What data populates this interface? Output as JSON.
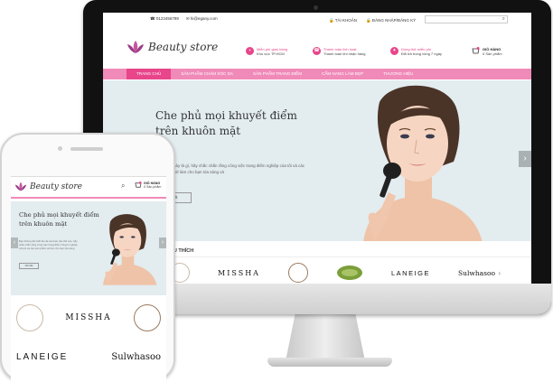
{
  "colors": {
    "accent": "#e8458b",
    "nav": "#f08ab8",
    "hero_bg": "#e3ecef"
  },
  "desktop": {
    "phone": "0123456789",
    "email": "hi@egany.com",
    "account": "TÀI KHOẢN",
    "login": "ĐĂNG NHẬP/ĐĂNG KÝ",
    "logo": "Beauty store",
    "features": [
      {
        "title": "Miễn phí giao hàng",
        "sub": "Khu vực TP.HCM",
        "icon": "truck-icon"
      },
      {
        "title": "Thanh toán linh hoạt",
        "sub": "Thanh toán khi nhận hàng",
        "icon": "phone-icon"
      },
      {
        "title": "Dùng thử miễn phí",
        "sub": "Đổi trả trong vòng 7 ngày",
        "icon": "gift-icon"
      }
    ],
    "cart": {
      "title": "GIỎ HÀNG",
      "count": "0",
      "sub": "Sản phẩm"
    },
    "nav": [
      "TRANG CHỦ",
      "SẢN PHẨM CHĂM SÓC DA",
      "SẢN PHẨM TRANG ĐIỂM",
      "CẨM NANG LÀM ĐẸP",
      "THƯƠNG HIỆU"
    ],
    "hero": {
      "title_line1": "Che phủ mọi khuyết điểm",
      "title_line2": "trên khuôn mặt",
      "text": "nhân đẹp này là gì, hãy chắc chắn rằng công việc trang điểm nghiệp của tôi và các sản phẩm sẽ làm cho bạn tỏa sáng và",
      "button": "hi tiết"
    },
    "favorites": "IỆU YÊU THÍCH",
    "brands": [
      "MISSHA",
      "LANEIGE",
      "Sulwhasoo"
    ]
  },
  "mobile": {
    "logo": "Beauty store",
    "cart": {
      "title": "GIỎ HÀNG",
      "count": "0",
      "sub": "Sản phẩm"
    },
    "hero": {
      "title_line1": "Che phủ mọi khuyết điểm",
      "title_line2": "trên khuôn mặt",
      "text": "Bạn không cần biết làn da của bạn xấu thế nào, hãy chắc chắn rằng công việc trang điểm chuyên nghiệp của tôi và các sản phẩm sẽ làm cho bạn tỏa sáng",
      "button": "Chi tiết"
    },
    "brands_row1": [
      "MISSHA"
    ],
    "brands_row2": [
      "LANEIGE",
      "Sulwhasoo"
    ]
  }
}
